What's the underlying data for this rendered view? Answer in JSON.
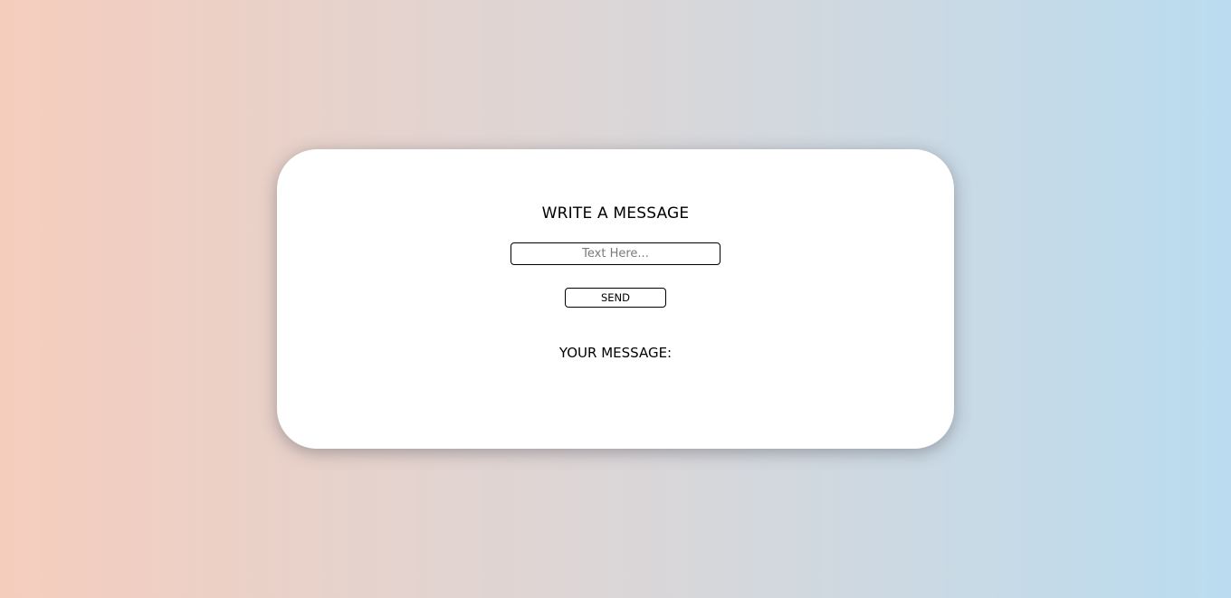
{
  "colors": {
    "background_left": "#f5cdbd",
    "background_mid": "#dbd6d7",
    "background_right": "#badcf0",
    "card": "#ffffff"
  },
  "card": {
    "title": "WRITE A MESSAGE",
    "input": {
      "value": "",
      "placeholder": "Text Here..."
    },
    "send_label": "SEND",
    "output_label": "YOUR MESSAGE:",
    "output_value": ""
  }
}
